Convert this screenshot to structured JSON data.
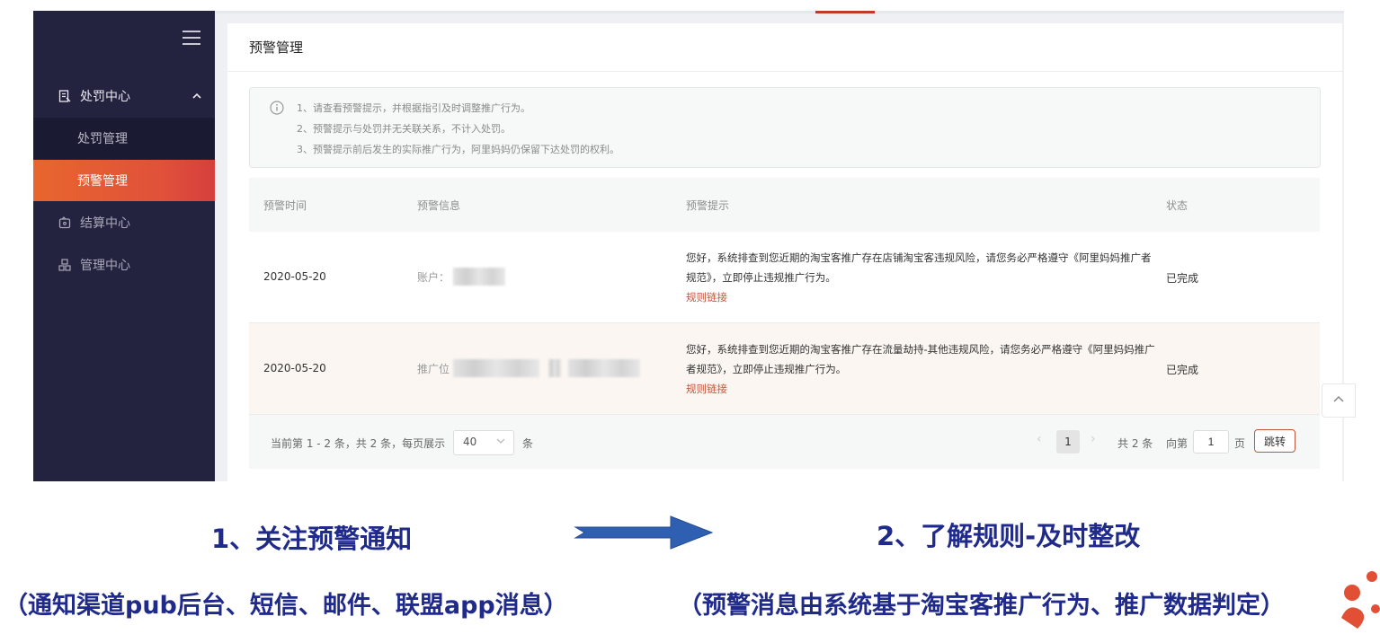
{
  "sidebar": {
    "groups": [
      {
        "label": "处罚中心",
        "icon": "document-icon",
        "expanded": true
      },
      {
        "label": "结算中心",
        "icon": "wallet-icon"
      },
      {
        "label": "管理中心",
        "icon": "group-icon"
      }
    ],
    "subitems": [
      {
        "label": "处罚管理",
        "active": false
      },
      {
        "label": "预警管理",
        "active": true
      }
    ]
  },
  "page": {
    "title": "预警管理"
  },
  "notice": {
    "lines": [
      "1、请查看预警提示，并根据指引及时调整推广行为。",
      "2、预警提示与处罚并无关联关系，不计入处罚。",
      "3、预警提示前后发生的实际推广行为，阿里妈妈仍保留下达处罚的权利。"
    ]
  },
  "table": {
    "headers": [
      "预警时间",
      "预警信息",
      "预警提示",
      "状态"
    ],
    "rows": [
      {
        "date": "2020-05-20",
        "info_label": "账户：",
        "tip": "您好，系统排查到您近期的淘宝客推广存在店铺淘宝客违规风险，请您务必严格遵守《阿里妈妈推广者规范》，立即停止违规推广行为。",
        "link": "规则链接",
        "status": "已完成"
      },
      {
        "date": "2020-05-20",
        "info_label": "推广位",
        "tip": "您好，系统排查到您近期的淘宝客推广存在流量劫持-其他违规风险，请您务必严格遵守《阿里妈妈推广者规范》，立即停止违规推广行为。",
        "link": "规则链接",
        "status": "已完成"
      }
    ]
  },
  "pagination": {
    "summary": "当前第 1 - 2 条，共 2 条，每页展示",
    "page_size": "40",
    "unit": "条",
    "current_page": "1",
    "total": "共 2 条",
    "goto_prefix": "向第",
    "goto_value": "1",
    "goto_suffix": "页",
    "goto_button": "跳转"
  },
  "slide": {
    "step1": "1、关注预警通知",
    "step2": "2、了解规则-及时整改",
    "sub1": "（通知渠道pub后台、短信、邮件、联盟app消息）",
    "sub2": "（预警消息由系统基于淘宝客推广行为、推广数据判定）"
  },
  "colors": {
    "sidebar_bg": "#23223f",
    "accent": "#e8662e",
    "caption": "#1f2a8a",
    "arrow": "#2f5fb0"
  }
}
